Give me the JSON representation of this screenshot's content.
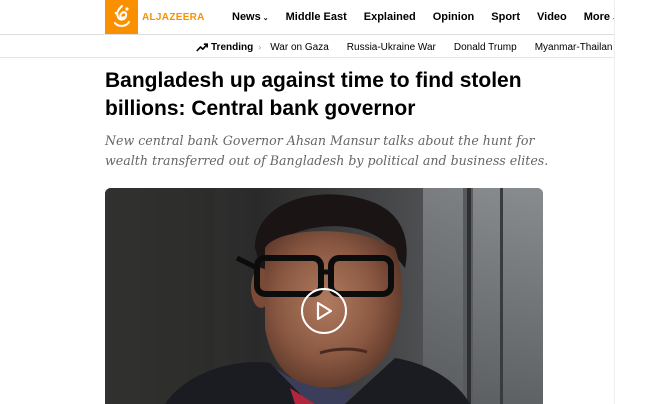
{
  "brand": {
    "name": "ALJAZEERA",
    "color": "#fa9000"
  },
  "nav": {
    "items": [
      {
        "label": "News",
        "has_dropdown": true
      },
      {
        "label": "Middle East",
        "has_dropdown": false
      },
      {
        "label": "Explained",
        "has_dropdown": false
      },
      {
        "label": "Opinion",
        "has_dropdown": false
      },
      {
        "label": "Sport",
        "has_dropdown": false
      },
      {
        "label": "Video",
        "has_dropdown": false
      },
      {
        "label": "More",
        "has_dropdown": true
      }
    ],
    "chevron_glyph": "⌄"
  },
  "trending": {
    "label": "Trending",
    "icon": "trending-up-icon",
    "separator": "›",
    "links": [
      "War on Gaza",
      "Russia-Ukraine War",
      "Donald Trump",
      "Myanmar-Thailan"
    ]
  },
  "article": {
    "headline": "Bangladesh up against time to find stolen billions: Central bank governor",
    "deck": "New central bank Governor Ahsan Mansur talks about the hunt for wealth transferred out of Bangladesh by political and business elites."
  },
  "video": {
    "play_icon": "play-icon"
  }
}
